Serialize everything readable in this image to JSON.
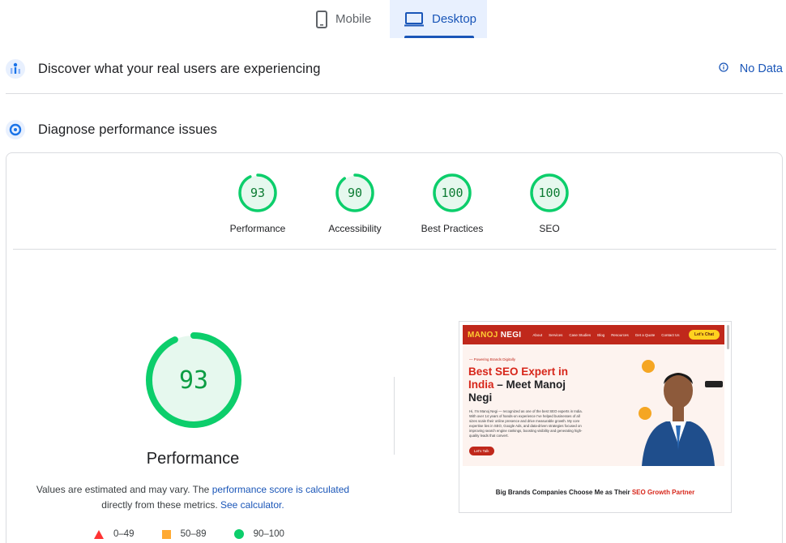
{
  "tabs": {
    "mobile": {
      "label": "Mobile",
      "icon": "mobile-phone-icon"
    },
    "desktop": {
      "label": "Desktop",
      "icon": "desktop-monitor-icon",
      "active": true
    }
  },
  "crux": {
    "title": "Discover what your real users are experiencing",
    "status": "No Data",
    "icon": "crux-users-icon"
  },
  "diagnose": {
    "title": "Diagnose performance issues",
    "icon": "lighthouse-gauge-icon"
  },
  "scores": [
    {
      "label": "Performance",
      "value": 93
    },
    {
      "label": "Accessibility",
      "value": 90
    },
    {
      "label": "Best Practices",
      "value": 100
    },
    {
      "label": "SEO",
      "value": 100
    }
  ],
  "main_score": {
    "value": 93,
    "title": "Performance",
    "disclaimer_text": "Values are estimated and may vary. The",
    "disclaimer_link1": "performance score is calculated",
    "disclaimer_text2": "directly from these metrics.",
    "disclaimer_link2": "See calculator."
  },
  "legend": {
    "poor": "0–49",
    "average": "50–89",
    "good": "90–100"
  },
  "colors": {
    "good": "#0cce6b",
    "average": "#ffaa33",
    "poor": "#ff3333",
    "accent": "#1a56b8"
  },
  "screenshot": {
    "logo_a": "MANOJ",
    "logo_b": "NEGI",
    "menu": [
      "About",
      "Services",
      "Case Studies",
      "Blog",
      "Resources",
      "Get a Quote",
      "Contact Us"
    ],
    "chat_btn": "Let's Chat",
    "tag": "— Powering Brands Digitally",
    "hero_red": "Best SEO Expert in India",
    "hero_dark": "– Meet Manoj Negi",
    "hero_body": "Hi, I'm Manoj Negi — recognized as one of the best SEO experts in India. With over 14 years of hands-on experience I've helped businesses of all sizes scale their online presence and drive measurable growth. My core expertise lies in SEO, Google Ads, and data-driven strategies focused on improving search engine rankings, boosting visibility and generating high-quality leads that convert.",
    "hero_btn": "Let's Talk",
    "brands_dark": "Big Brands Companies Choose Me as Their",
    "brands_red": "SEO Growth Partner"
  }
}
